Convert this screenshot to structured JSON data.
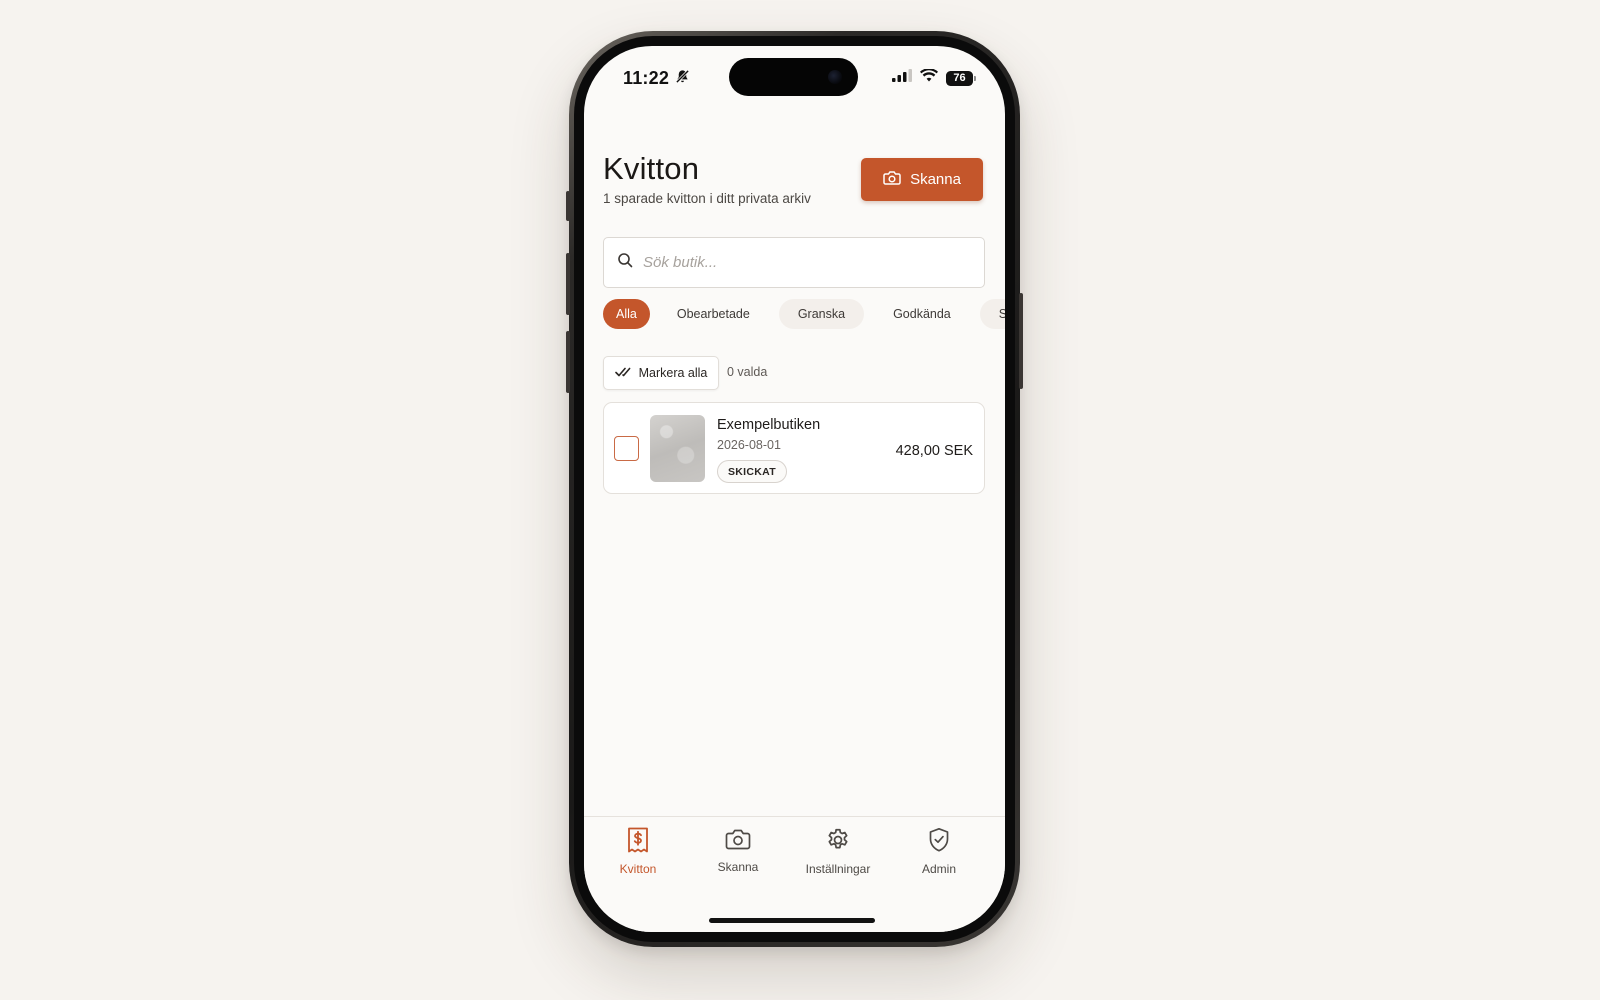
{
  "status_bar": {
    "time": "11:22",
    "battery": "76",
    "silent_icon": "bell-slash-icon",
    "signal_icon": "cellular-signal-icon",
    "wifi_icon": "wifi-icon"
  },
  "header": {
    "title": "Kvitton",
    "subtitle": "1 sparade kvitton i ditt privata arkiv",
    "scan_button_label": "Skanna",
    "scan_button_icon": "camera-icon"
  },
  "search": {
    "value": "",
    "placeholder": "Sök butik..."
  },
  "filters": [
    {
      "label": "Alla",
      "active": true
    },
    {
      "label": "Obearbetade",
      "active": false
    },
    {
      "label": "Granska",
      "active": false
    },
    {
      "label": "Godkända",
      "active": false
    },
    {
      "label": "Skickade",
      "active": false
    }
  ],
  "selection": {
    "select_all_label": "Markera alla",
    "selected_count": "0 valda"
  },
  "receipts": [
    {
      "store": "Exempelbutiken",
      "date": "2026-08-01",
      "status": "SKICKAT",
      "amount": "428,00 SEK",
      "checked": false
    }
  ],
  "tabbar": {
    "items": [
      {
        "label": "Kvitton",
        "icon": "receipt-icon",
        "active": true
      },
      {
        "label": "Skanna",
        "icon": "camera-icon",
        "active": false
      },
      {
        "label": "Inställningar",
        "icon": "gear-icon",
        "active": false
      },
      {
        "label": "Admin",
        "icon": "shield-check-icon",
        "active": false
      }
    ]
  },
  "colors": {
    "accent": "#c4562b",
    "background": "#f6f3ef",
    "screen": "#fbfaf8"
  }
}
